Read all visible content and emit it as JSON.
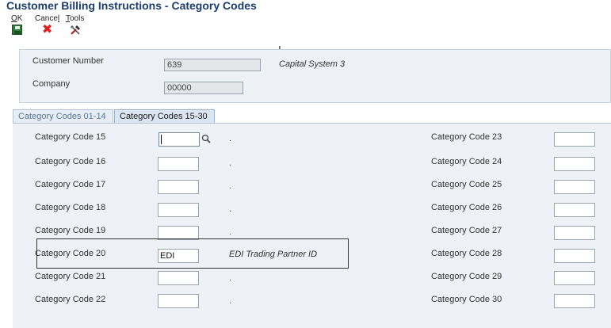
{
  "window": {
    "title": "Customer Billing Instructions - Category Codes"
  },
  "toolbar": {
    "ok_label": "OK",
    "ok_mnemonic": "O",
    "ok_rest": "K",
    "cancel_label": "Cancel",
    "cancel_pre": "Cance",
    "cancel_mnemonic": "l",
    "tools_label": "Tools",
    "tools_mnemonic": "T",
    "tools_rest": "ools"
  },
  "header": {
    "customer_number_label": "Customer Number",
    "customer_number_value": "639",
    "customer_name": "Capital System 3",
    "company_label": "Company",
    "company_value": "00000"
  },
  "tabs": [
    {
      "label": "Category Codes 01-14",
      "active": false
    },
    {
      "label": "Category Codes 15-30",
      "active": true
    }
  ],
  "left_codes": [
    {
      "label": "Category Code 15",
      "value": "",
      "desc": "."
    },
    {
      "label": "Category Code 16",
      "value": "",
      "desc": "."
    },
    {
      "label": "Category Code 17",
      "value": "",
      "desc": "."
    },
    {
      "label": "Category Code 18",
      "value": "",
      "desc": "."
    },
    {
      "label": "Category Code 19",
      "value": "",
      "desc": "."
    },
    {
      "label": "Category Code 20",
      "value": "EDI",
      "desc": "EDI Trading Partner ID"
    },
    {
      "label": "Category Code 21",
      "value": "",
      "desc": "."
    },
    {
      "label": "Category Code 22",
      "value": "",
      "desc": "."
    }
  ],
  "right_codes": [
    {
      "label": "Category Code 23",
      "value": ""
    },
    {
      "label": "Category Code 24",
      "value": ""
    },
    {
      "label": "Category Code 25",
      "value": ""
    },
    {
      "label": "Category Code 26",
      "value": ""
    },
    {
      "label": "Category Code 27",
      "value": ""
    },
    {
      "label": "Category Code 28",
      "value": ""
    },
    {
      "label": "Category Code 29",
      "value": ""
    },
    {
      "label": "Category Code 30",
      "value": ""
    }
  ],
  "colors": {
    "title": "#1b3d6b",
    "panel_bg": "#eef1f5",
    "tab_active_bg": "#dbe6f2",
    "tab_inactive_text": "#5a7796",
    "cancel_icon": "#dd2222",
    "ok_icon": "#2d7a3a"
  },
  "icons": {
    "ok": "save-disk-icon",
    "cancel": "red-x-icon",
    "tools": "tools-icon",
    "search": "magnifier-icon",
    "cursor": "text-cursor-icon"
  }
}
